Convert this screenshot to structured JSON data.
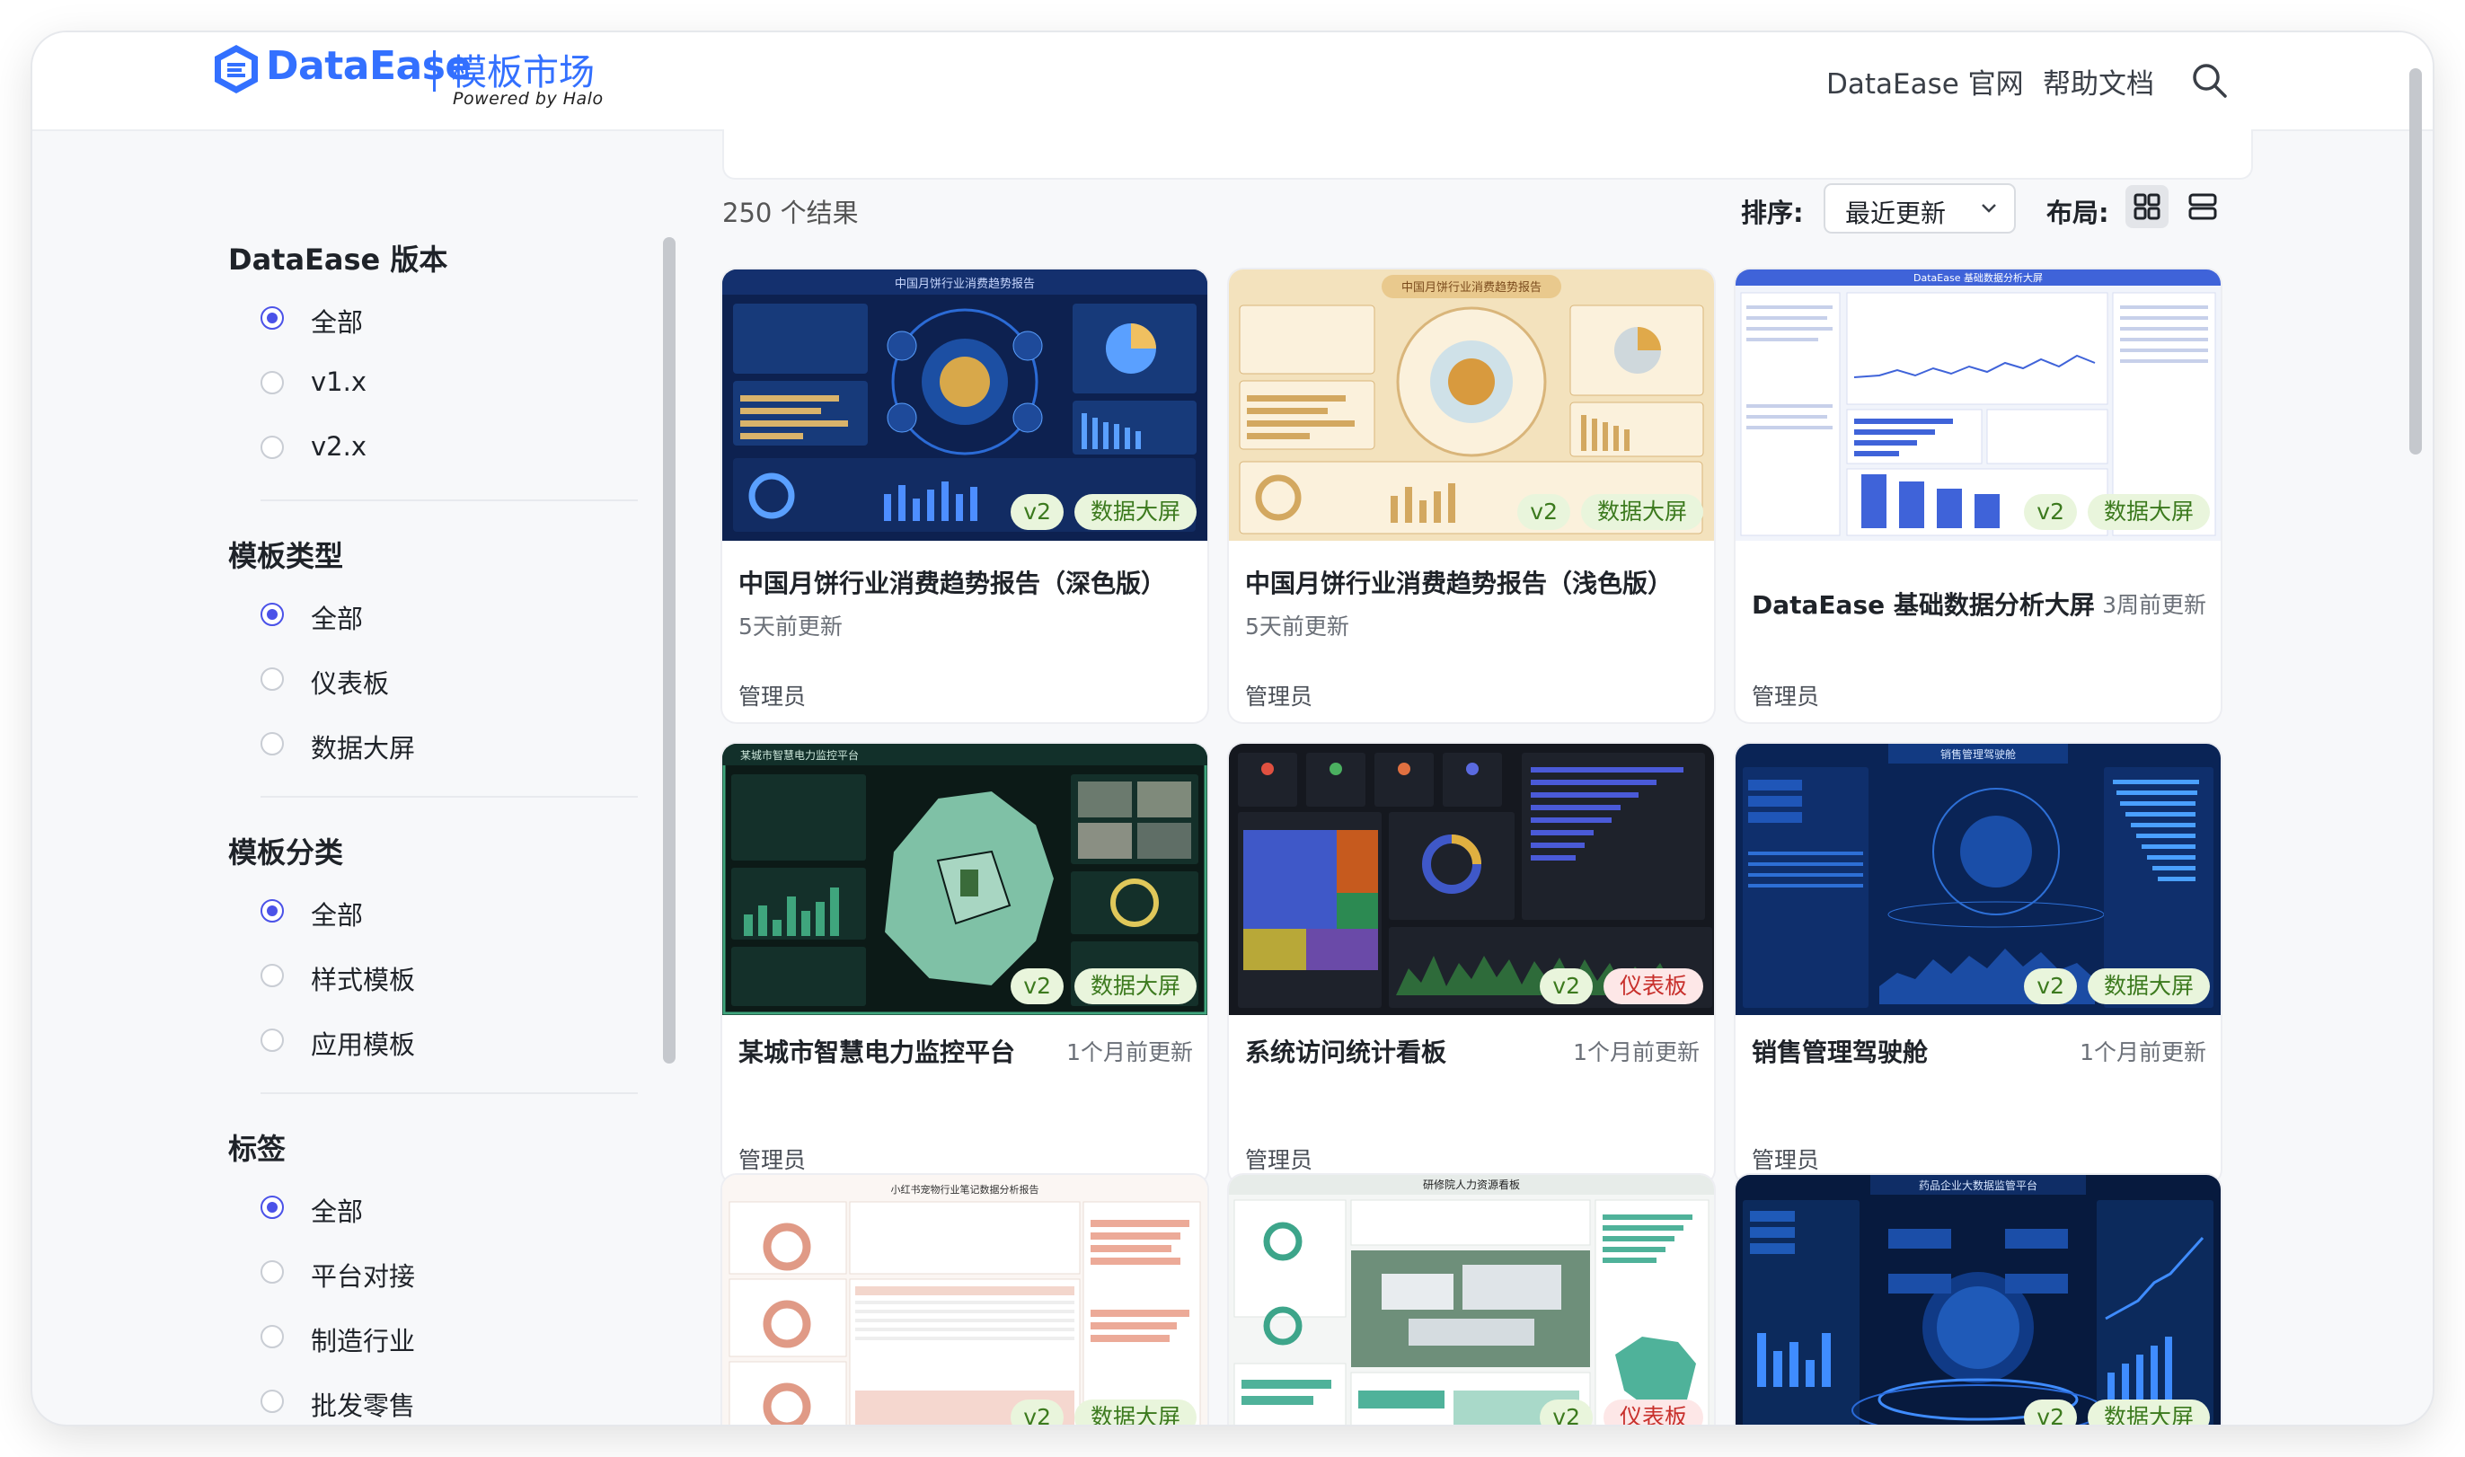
{
  "header": {
    "brand": "DataEase",
    "title": "模板市场",
    "subtitle": "Powered by Halo",
    "nav": [
      "DataEase 官网",
      "帮助文档"
    ]
  },
  "sidebar": {
    "groups": [
      {
        "title": "DataEase 版本",
        "options": [
          {
            "label": "全部",
            "selected": true
          },
          {
            "label": "v1.x",
            "selected": false
          },
          {
            "label": "v2.x",
            "selected": false
          }
        ]
      },
      {
        "title": "模板类型",
        "options": [
          {
            "label": "全部",
            "selected": true
          },
          {
            "label": "仪表板",
            "selected": false
          },
          {
            "label": "数据大屏",
            "selected": false
          }
        ]
      },
      {
        "title": "模板分类",
        "options": [
          {
            "label": "全部",
            "selected": true
          },
          {
            "label": "样式模板",
            "selected": false
          },
          {
            "label": "应用模板",
            "selected": false
          }
        ]
      },
      {
        "title": "标签",
        "options": [
          {
            "label": "全部",
            "selected": true
          },
          {
            "label": "平台对接",
            "selected": false
          },
          {
            "label": "制造行业",
            "selected": false
          },
          {
            "label": "批发零售",
            "selected": false
          }
        ]
      }
    ]
  },
  "toolbar": {
    "result_count": "250 个结果",
    "sort_label": "排序:",
    "sort_value": "最近更新",
    "layout_label": "布局:"
  },
  "cards": [
    {
      "title": "中国月饼行业消费趋势报告（深色版）",
      "updated": "5天前更新",
      "author": "管理员",
      "version": "v2",
      "type": "数据大屏"
    },
    {
      "title": "中国月饼行业消费趋势报告（浅色版）",
      "updated": "5天前更新",
      "author": "管理员",
      "version": "v2",
      "type": "数据大屏"
    },
    {
      "title": "DataEase 基础数据分析大屏",
      "updated": "3周前更新",
      "author": "管理员",
      "version": "v2",
      "type": "数据大屏"
    },
    {
      "title": "某城市智慧电力监控平台",
      "updated": "1个月前更新",
      "author": "管理员",
      "version": "v2",
      "type": "数据大屏"
    },
    {
      "title": "系统访问统计看板",
      "updated": "1个月前更新",
      "author": "管理员",
      "version": "v2",
      "type": "仪表板"
    },
    {
      "title": "销售管理驾驶舱",
      "updated": "1个月前更新",
      "author": "管理员",
      "version": "v2",
      "type": "数据大屏"
    },
    {
      "title": "",
      "updated": "",
      "author": "",
      "version": "v2",
      "type": "数据大屏"
    },
    {
      "title": "",
      "updated": "",
      "author": "",
      "version": "v2",
      "type": "仪表板"
    },
    {
      "title": "",
      "updated": "",
      "author": "",
      "version": "v2",
      "type": "数据大屏"
    }
  ],
  "thumb_texts": [
    "中国月饼行业消费趋势报告",
    "中国月饼行业消费趋势报告",
    "DataEase 基础数据分析大屏",
    "某城市智慧电力监控平台",
    "",
    "销售管理驾驶舱",
    "小红书宠物行业笔记数据分析报告",
    "研修院人力资源看板",
    "药品企业大数据监管平台"
  ],
  "colors": {
    "accent": "#3370ff",
    "radio": "#4b52e8",
    "badge_green_bg": "#e9f5dc",
    "badge_red_bg": "#fde7e7"
  },
  "icons": {
    "search": "search-icon",
    "sort": "chevron-down-icon",
    "grid": "grid-view-icon",
    "list": "list-view-icon"
  }
}
